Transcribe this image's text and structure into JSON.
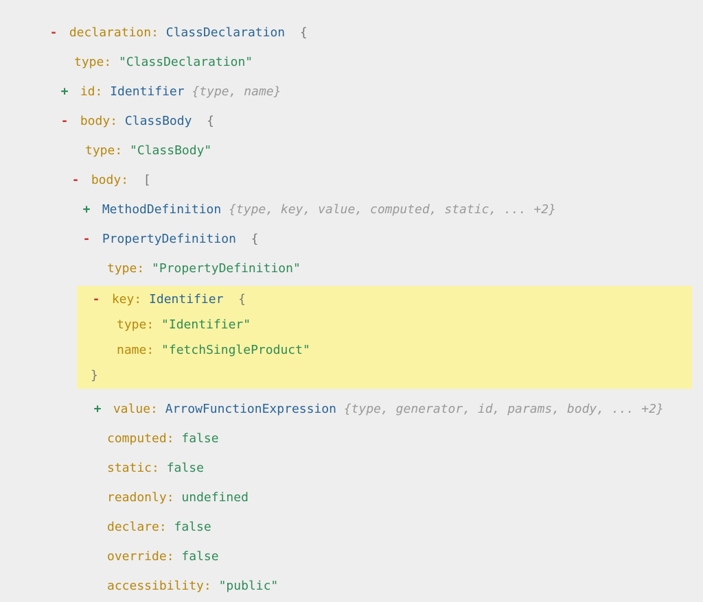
{
  "tree": {
    "declaration": {
      "toggle": "-",
      "key": "declaration",
      "typename": "ClassDeclaration",
      "open": "{",
      "children": {
        "type": {
          "key": "type",
          "value": "\"ClassDeclaration\""
        },
        "id": {
          "toggle": "+",
          "key": "id",
          "typename": "Identifier",
          "summary": "{type, name}"
        },
        "body": {
          "toggle": "-",
          "key": "body",
          "typename": "ClassBody",
          "open": "{",
          "children": {
            "type": {
              "key": "type",
              "value": "\"ClassBody\""
            },
            "bodyArr": {
              "toggle": "-",
              "key": "body",
              "open": "[",
              "items": {
                "method": {
                  "toggle": "+",
                  "typename": "MethodDefinition",
                  "summary": "{type, key, value, computed, static, ... +2}"
                },
                "propdef": {
                  "toggle": "-",
                  "typename": "PropertyDefinition",
                  "open": "{",
                  "children": {
                    "type": {
                      "key": "type",
                      "value": "\"PropertyDefinition\""
                    },
                    "keyNode": {
                      "toggle": "-",
                      "key": "key",
                      "typename": "Identifier",
                      "open": "{",
                      "children": {
                        "type": {
                          "key": "type",
                          "value": "\"Identifier\""
                        },
                        "name": {
                          "key": "name",
                          "value": "\"fetchSingleProduct\""
                        }
                      },
                      "close": "}"
                    },
                    "valueNode": {
                      "toggle": "+",
                      "key": "value",
                      "typename": "ArrowFunctionExpression",
                      "summary": "{type, generator, id, params, body, ... +2}"
                    },
                    "computed": {
                      "key": "computed",
                      "value": "false"
                    },
                    "static": {
                      "key": "static",
                      "value": "false"
                    },
                    "readonly": {
                      "key": "readonly",
                      "value": "undefined"
                    },
                    "declare": {
                      "key": "declare",
                      "value": "false"
                    },
                    "override": {
                      "key": "override",
                      "value": "false"
                    },
                    "accessibility": {
                      "key": "accessibility",
                      "value": "\"public\""
                    }
                  }
                }
              }
            }
          }
        }
      }
    }
  }
}
